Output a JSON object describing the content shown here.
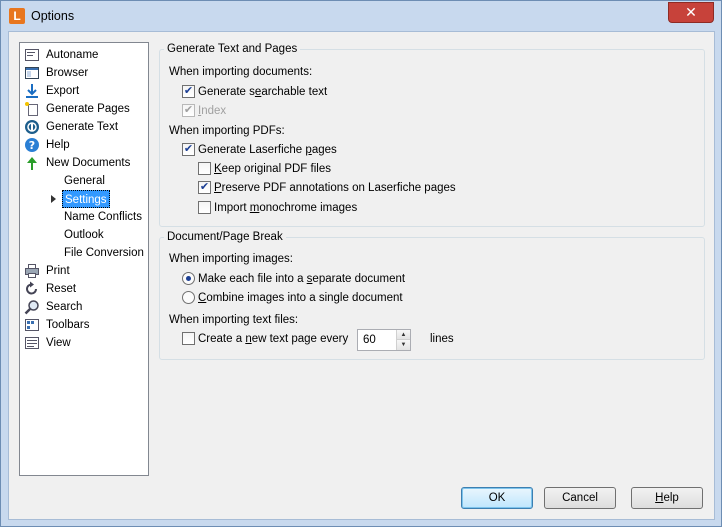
{
  "window": {
    "title": "Options",
    "app_icon_letter": "L",
    "close_glyph": "✕"
  },
  "tree": {
    "items": [
      {
        "label": "Autoname",
        "icon": "autoname-icon"
      },
      {
        "label": "Browser",
        "icon": "browser-icon"
      },
      {
        "label": "Export",
        "icon": "export-icon"
      },
      {
        "label": "Generate Pages",
        "icon": "generate-pages-icon"
      },
      {
        "label": "Generate Text",
        "icon": "generate-text-icon"
      },
      {
        "label": "Help",
        "icon": "help-icon"
      },
      {
        "label": "New Documents",
        "icon": "new-documents-icon"
      },
      {
        "label": "General"
      },
      {
        "label": "Settings"
      },
      {
        "label": "Name Conflicts"
      },
      {
        "label": "Outlook"
      },
      {
        "label": "File Conversion"
      },
      {
        "label": "Print",
        "icon": "print-icon"
      },
      {
        "label": "Reset",
        "icon": "reset-icon"
      },
      {
        "label": "Search",
        "icon": "search-icon"
      },
      {
        "label": "Toolbars",
        "icon": "toolbars-icon"
      },
      {
        "label": "View",
        "icon": "view-icon"
      }
    ],
    "selected": "Settings"
  },
  "text_pages": {
    "title": "Generate Text and Pages",
    "importing_documents_label": "When importing documents:",
    "gen_searchable_text": {
      "pre": "Generate s",
      "u": "e",
      "post": "archable text",
      "checked": true
    },
    "index": {
      "pre": "",
      "u": "I",
      "post": "ndex",
      "checked": true,
      "disabled": true
    },
    "importing_pdfs_label": "When importing PDFs:",
    "gen_laserfiche_pages": {
      "pre": "Generate Laserfiche ",
      "u": "p",
      "post": "ages",
      "checked": true
    },
    "keep_original_pdf": {
      "pre": "",
      "u": "K",
      "post": "eep original PDF files",
      "checked": false
    },
    "preserve_pdf_annotations": {
      "pre": "",
      "u": "P",
      "post": "reserve PDF annotations on Laserfiche pages",
      "checked": true
    },
    "import_monochrome": {
      "pre": "Import ",
      "u": "m",
      "post": "onochrome images",
      "checked": false
    }
  },
  "page_break": {
    "title": "Document/Page Break",
    "importing_images_label": "When importing images:",
    "separate_document": {
      "pre": "Make each file into a ",
      "u": "s",
      "post": "eparate document",
      "selected": true
    },
    "combine_images": {
      "pre": "",
      "u": "C",
      "post": "ombine images into a single document",
      "selected": false
    },
    "importing_text_files_label": "When importing text files:",
    "new_text_page": {
      "pre": "Create a ",
      "u": "n",
      "post": "ew text page every",
      "checked": false
    },
    "lines_value": "60",
    "lines_label": "lines"
  },
  "buttons": {
    "ok": "OK",
    "cancel": "Cancel",
    "help": {
      "pre": "",
      "u": "H",
      "post": "elp"
    }
  }
}
